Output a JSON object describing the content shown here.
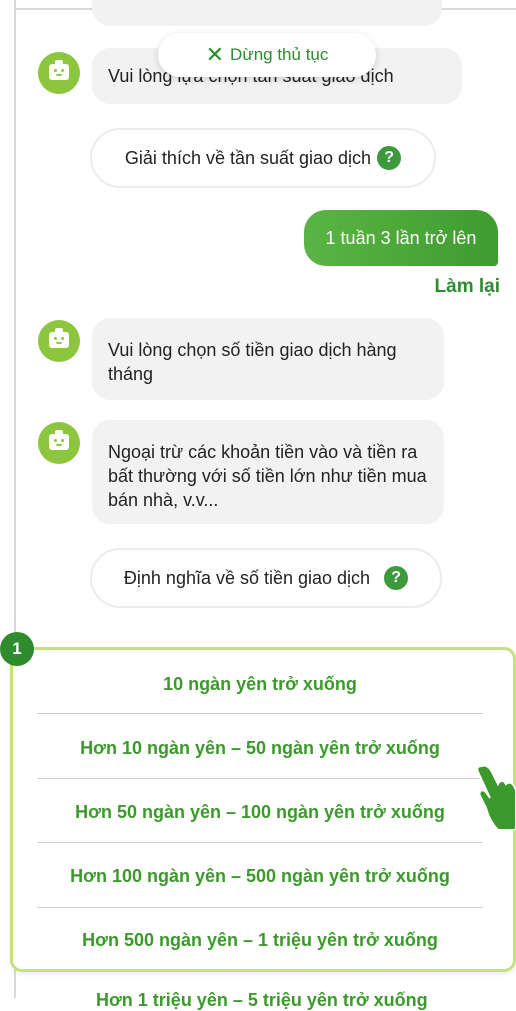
{
  "header": {
    "stop_label": "Dừng thủ tục"
  },
  "messages": [
    {
      "from": "bot",
      "text": "Vui lòng lựa chọn tần suất giao dịch"
    },
    {
      "from": "bot",
      "text": "Vui lòng chọn số tiền giao dịch hàng tháng"
    },
    {
      "from": "bot",
      "text": "Ngoại trừ các khoản tiền vào và tiền ra bất thường với số tiền lớn như tiền mua bán nhà, v.v..."
    }
  ],
  "help_buttons": {
    "frequency": "Giải thích về tần suất giao dịch",
    "amount": "Định nghĩa về số tiền giao dịch"
  },
  "user_reply": "1 tuần 3 lần trở lên",
  "redo_label": "Làm lại",
  "step_badge": "1",
  "options": [
    "10 ngàn yên trở xuống",
    "Hơn 10 ngàn yên – 50 ngàn yên trở xuống",
    "Hơn 50 ngàn yên – 100 ngàn yên trở xuống",
    "Hơn 100 ngàn yên – 500 ngàn yên trở xuống",
    "Hơn 500 ngàn yên – 1 triệu yên trở xuống"
  ],
  "cutoff_option": "Hơn 1 triệu yên – 5 triệu yên trở xuống",
  "colors": {
    "brand_green": "#3c9a2c",
    "avatar_green": "#8cc63f",
    "panel_border": "#c5e07e"
  }
}
